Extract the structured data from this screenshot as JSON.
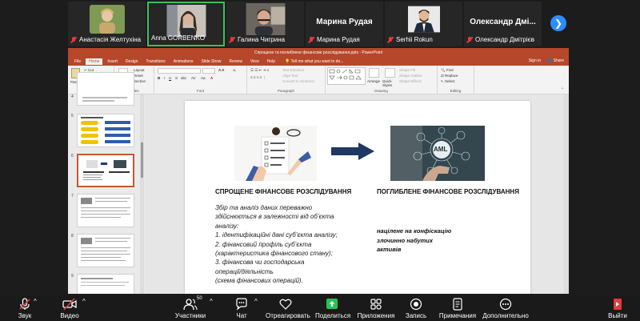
{
  "participants": [
    {
      "name": "Анастасія Желтухіна",
      "muted": true,
      "type": "photo"
    },
    {
      "name": "Anna GORBENKO",
      "muted": false,
      "type": "video",
      "active": true
    },
    {
      "name": "Галина Чигрина",
      "muted": true,
      "type": "video"
    },
    {
      "name": "Марина Рудая",
      "display_name": "Марина Рудая",
      "muted": true,
      "type": "name"
    },
    {
      "name": "Serhii Rokun",
      "muted": true,
      "type": "photo"
    },
    {
      "name": "Олександр Дмітрієв",
      "display_name": "Олександр Дмі...",
      "muted": true,
      "type": "name"
    }
  ],
  "ppt": {
    "window_title": "Спрощене та поглиблене фінансове розслідування.pptx - PowerPoint",
    "tabs": [
      "File",
      "Home",
      "Insert",
      "Design",
      "Transitions",
      "Animations",
      "Slide Show",
      "Review",
      "View",
      "Help"
    ],
    "active_tab": "Home",
    "tell_me": "Tell me what you want to do...",
    "sign_in": "Sign in",
    "share": "Share",
    "ribbon": {
      "clipboard": {
        "paste": "Paste",
        "cut": "Cut",
        "copy": "Copy",
        "format_painter": "Format Painter",
        "group": "Clipboard"
      },
      "slides": {
        "new_slide": "New Slide",
        "layout": "Layout",
        "reset": "Reset",
        "section": "Section",
        "group": "Slides"
      },
      "font": {
        "group": "Font"
      },
      "paragraph": {
        "text_direction": "Text Direction",
        "align_text": "Align Text",
        "smartart": "Convert to SmartArt",
        "group": "Paragraph"
      },
      "drawing": {
        "arrange": "Arrange",
        "quick_styles": "Quick Styles",
        "shape_fill": "Shape Fill",
        "shape_outline": "Shape Outline",
        "shape_effects": "Shape Effects",
        "group": "Drawing"
      },
      "editing": {
        "find": "Find",
        "replace": "Replace",
        "select": "Select",
        "group": "Editing"
      }
    },
    "slide_numbers": [
      "4",
      "5",
      "6",
      "7",
      "8",
      "9"
    ],
    "slide": {
      "left_heading": "СПРОЩЕНЕ ФІНАНСОВЕ РОЗСЛІДУВАННЯ",
      "right_heading": "ПОГЛИБЛЕНЕ ФІНАНСОВЕ РОЗСЛІДУВАННЯ",
      "left_body": [
        "Збір та аналіз даних переважно",
        "здійснюється в залежності від об’єкта",
        "аналізу:",
        "1. ідентифікаційні дані суб’єкта аналізу;",
        "2. фінансовий профіль суб’єкта",
        "(характеристика фінансового стану);",
        "3. фінансова чи господарська",
        "операції/діяльність",
        "(схема фінансових операцій)."
      ],
      "right_body": [
        "націлене на конфіскацію",
        "злочинно набутих",
        "активів"
      ],
      "aml_label": "AML"
    }
  },
  "toolbar": {
    "audio": "Звук",
    "video": "Видео",
    "participants": "Участники",
    "participants_count": "50",
    "chat": "Чат",
    "react": "Отреагировать",
    "share": "Поделиться",
    "apps": "Приложения",
    "record": "Запись",
    "notes": "Примечания",
    "more": "Дополнительно",
    "leave": "Выйти"
  },
  "colors": {
    "accent": "#b7472a",
    "active_tile": "#3fbf5a",
    "share_green": "#23c552",
    "mute_red": "#e23b3b"
  }
}
